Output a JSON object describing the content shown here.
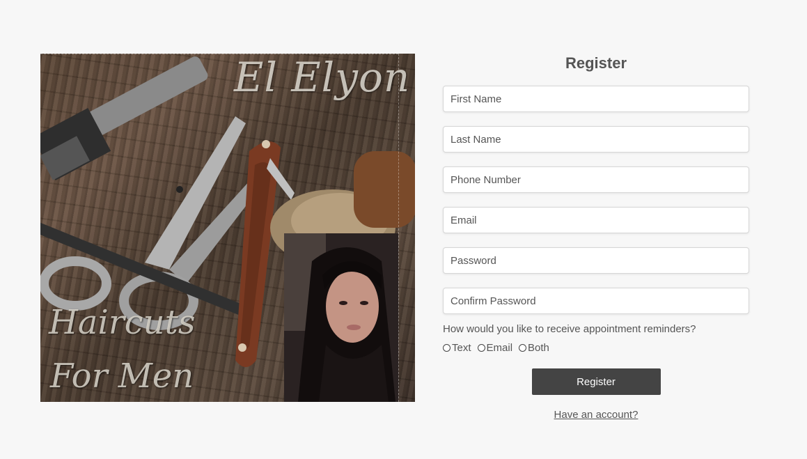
{
  "hero": {
    "title": "El Elyon",
    "subtitle_line1": "Haircuts",
    "subtitle_line2": "For Men"
  },
  "form": {
    "title": "Register",
    "fields": {
      "first_name": {
        "placeholder": "First Name",
        "value": ""
      },
      "last_name": {
        "placeholder": "Last Name",
        "value": ""
      },
      "phone": {
        "placeholder": "Phone Number",
        "value": ""
      },
      "email": {
        "placeholder": "Email",
        "value": ""
      },
      "password": {
        "placeholder": "Password",
        "value": ""
      },
      "confirm_password": {
        "placeholder": "Confirm Password",
        "value": ""
      }
    },
    "reminder_question": "How would you like to receive appointment reminders?",
    "reminder_options": {
      "text": "Text",
      "email": "Email",
      "both": "Both"
    },
    "submit_label": "Register",
    "login_link": "Have an account?"
  },
  "colors": {
    "background": "#f7f7f7",
    "button": "#444444",
    "text": "#555555"
  }
}
